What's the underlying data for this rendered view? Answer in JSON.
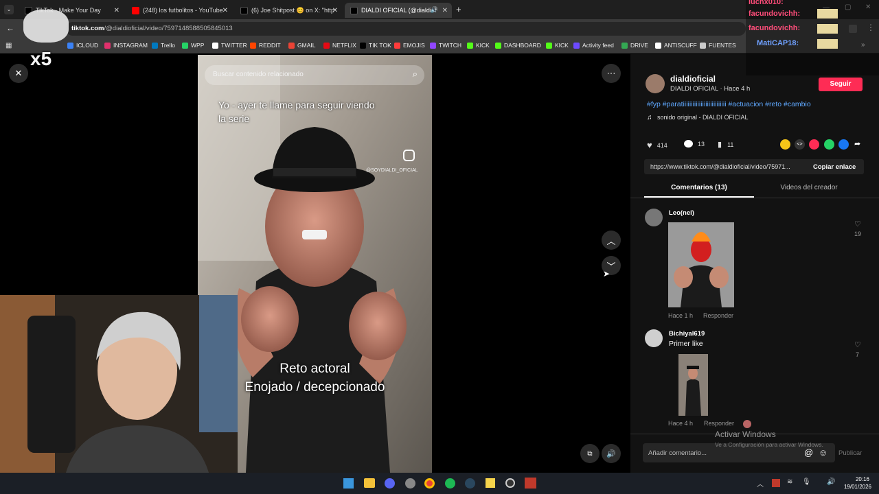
{
  "tabs": [
    {
      "title": "TikTok - Make Your Day",
      "color": "#000000"
    },
    {
      "title": "(248) los futbolitos - YouTube",
      "color": "#ff0000"
    },
    {
      "title": "(6) Joe Shitpost 😊 on X: \"http",
      "color": "#000000"
    },
    {
      "title": "DIALDI OFICIAL (@dialdioficial)",
      "color": "#000000"
    }
  ],
  "address": {
    "host": "tiktok.com",
    "path": "/@dialdioficial/video/7597148588505845013"
  },
  "bookmarks": [
    {
      "label": "ICLOUD",
      "color": "#3b82f6"
    },
    {
      "label": "INSTAGRAM",
      "color": "#e1306c"
    },
    {
      "label": "Trello",
      "color": "#0079bf"
    },
    {
      "label": "WPP",
      "color": "#25d366"
    },
    {
      "label": "TWITTER",
      "color": "#ffffff"
    },
    {
      "label": "REDDIT",
      "color": "#ff4500"
    },
    {
      "label": "GMAIL",
      "color": "#ea4335"
    },
    {
      "label": "NETFLIX",
      "color": "#e50914"
    },
    {
      "label": "TIK TOK",
      "color": "#000000"
    },
    {
      "label": "EMOJIS",
      "color": "#ff3b3b"
    },
    {
      "label": "TWITCH",
      "color": "#9146ff"
    },
    {
      "label": "KICK",
      "color": "#53fc18"
    },
    {
      "label": "DASHBOARD",
      "color": "#53fc18"
    },
    {
      "label": "KICK",
      "color": "#53fc18"
    },
    {
      "label": "Activity feed",
      "color": "#6d4aff"
    },
    {
      "label": "DRIVE",
      "color": "#34a853"
    },
    {
      "label": "ANTISCUFF",
      "color": "#ffffff"
    },
    {
      "label": "FUENTES",
      "color": "#cccccc"
    }
  ],
  "video": {
    "search_placeholder": "Buscar contenido relacionado",
    "caption_top": "Yo - ayer te llame para seguir viendo la serie",
    "watermark": "@SOYDIALDI_OFICIAL",
    "caption_bottom_1": "Reto actoral",
    "caption_bottom_2": "Enojado / decepcionado"
  },
  "author": {
    "username": "dialdioficial",
    "display": "DIALDI OFICIAL · Hace 4 h",
    "follow_label": "Seguir",
    "hashtags": "#fyp #paratiiiiiiiiiiiiiiiiiiiiiiiiiii #actuacion #reto #cambio",
    "sound": "sonido original - DIALDI OFICIAL"
  },
  "stats": {
    "likes": "414",
    "comments": "13",
    "saves": "11"
  },
  "share": {
    "link": "https://www.tiktok.com/@dialdioficial/video/75971...",
    "copy_label": "Copiar enlace"
  },
  "tabs_panel": {
    "comments": "Comentarios (13)",
    "creator": "Videos del creador"
  },
  "comments": [
    {
      "name": "Leo(nel)",
      "time": "Hace 1 h",
      "reply": "Responder",
      "likes": "19"
    },
    {
      "name": "Bichiyal619",
      "text": "Primer like",
      "time": "Hace 4 h",
      "reply": "Responder",
      "likes": "7"
    }
  ],
  "composer": {
    "placeholder": "Añadir comentario...",
    "publish": "Publicar"
  },
  "windows": {
    "activate_title": "Activar Windows",
    "activate_sub": "Ve a Configuración para activar Windows."
  },
  "clock": {
    "time": "20:16",
    "date": "19/01/2026"
  },
  "overlay": {
    "multiplier": "x5",
    "chat": [
      {
        "user": "luchx010:"
      },
      {
        "user": "facundovichh:"
      },
      {
        "user": "facundovichh:"
      },
      {
        "user": "MatiCAP18:"
      }
    ]
  },
  "accent": "#fe2c55",
  "link_color": "#5fa8ff"
}
